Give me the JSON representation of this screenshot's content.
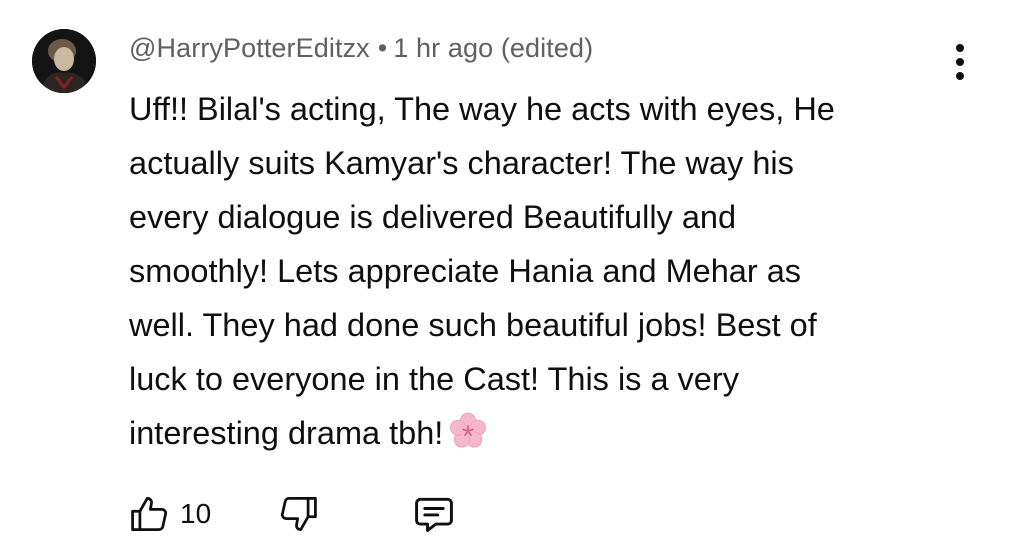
{
  "comment": {
    "author": "@HarryPotterEditzx",
    "separator": "•",
    "time": "1 hr ago (edited)",
    "lines": [
      "Uff!! Bilal's acting, The way he acts with eyes, He",
      "actually suits Kamyar's character! The way his",
      "every dialogue is delivered Beautifully and",
      "smoothly! Lets appreciate Hania and Mehar as",
      "well. They had done such beautiful jobs! Best of",
      "luck to everyone in the Cast! This is a very",
      "interesting drama tbh!"
    ],
    "emoji_icon": "cherry-blossom-icon",
    "like_count": "10"
  },
  "icons": {
    "avatar": "avatar",
    "menu": "more-vertical-icon",
    "like": "thumbs-up-icon",
    "dislike": "thumbs-down-icon",
    "reply": "reply-comment-icon"
  },
  "colors": {
    "text": "#0f0f0f",
    "meta": "#606060",
    "background": "#ffffff",
    "emoji_pink": "#f6b6cc"
  }
}
